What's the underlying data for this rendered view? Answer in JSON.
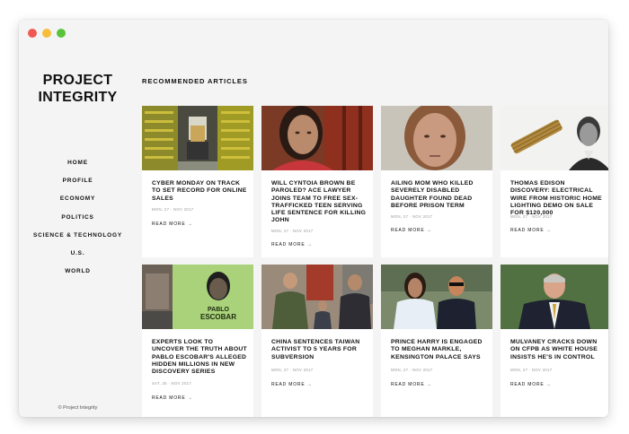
{
  "site": {
    "logo_line1": "PROJECT",
    "logo_line2": "INTEGRITY",
    "copyright": "© Project Integrity"
  },
  "nav": [
    "HOME",
    "PROFILE",
    "ECONOMY",
    "POLITICS",
    "SCIENCE & TECHNOLOGY",
    "U.S.",
    "WORLD"
  ],
  "main": {
    "section_title": "RECOMMENDED ARTICLES",
    "read_more_label": "READ MORE →"
  },
  "articles": [
    {
      "title": "CYBER MONDAY ON TRACK TO SET RECORD FOR ONLINE SALES",
      "date": "MON, 27 · NOV 2017"
    },
    {
      "title": "WILL CYNTOIA BROWN BE PAROLED? ACE LAWYER JOINS TEAM TO FREE SEX-TRAFFICKED TEEN SERVING LIFE SENTENCE FOR KILLING JOHN",
      "date": "MON, 27 · NOV 2017"
    },
    {
      "title": "AILING MOM WHO KILLED SEVERELY DISABLED DAUGHTER FOUND DEAD BEFORE PRISON TERM",
      "date": "MON, 27 · NOV 2017"
    },
    {
      "title": "THOMAS EDISON DISCOVERY: ELECTRICAL WIRE FROM HISTORIC HOME LIGHTING DEMO ON SALE FOR $120,000",
      "date": "MON, 27 · NOV 2017"
    },
    {
      "title": "EXPERTS LOOK TO UNCOVER THE TRUTH ABOUT PABLO ESCOBAR'S ALLEGED HIDDEN MILLIONS IN NEW DISCOVERY SERIES",
      "date": "SAT, 25 · NOV 2017"
    },
    {
      "title": "CHINA SENTENCES TAIWAN ACTIVIST TO 5 YEARS FOR SUBVERSION",
      "date": "MON, 27 · NOV 2017"
    },
    {
      "title": "PRINCE HARRY IS ENGAGED TO MEGHAN MARKLE, KENSINGTON PALACE SAYS",
      "date": "MON, 27 · NOV 2017"
    },
    {
      "title": "MULVANEY CRACKS DOWN ON CFPB AS WHITE HOUSE INSISTS HE'S IN CONTROL",
      "date": "MON, 27 · NOV 2017"
    }
  ],
  "poster_text": {
    "line1": "PABLO",
    "line2": "ESCOBAR"
  }
}
